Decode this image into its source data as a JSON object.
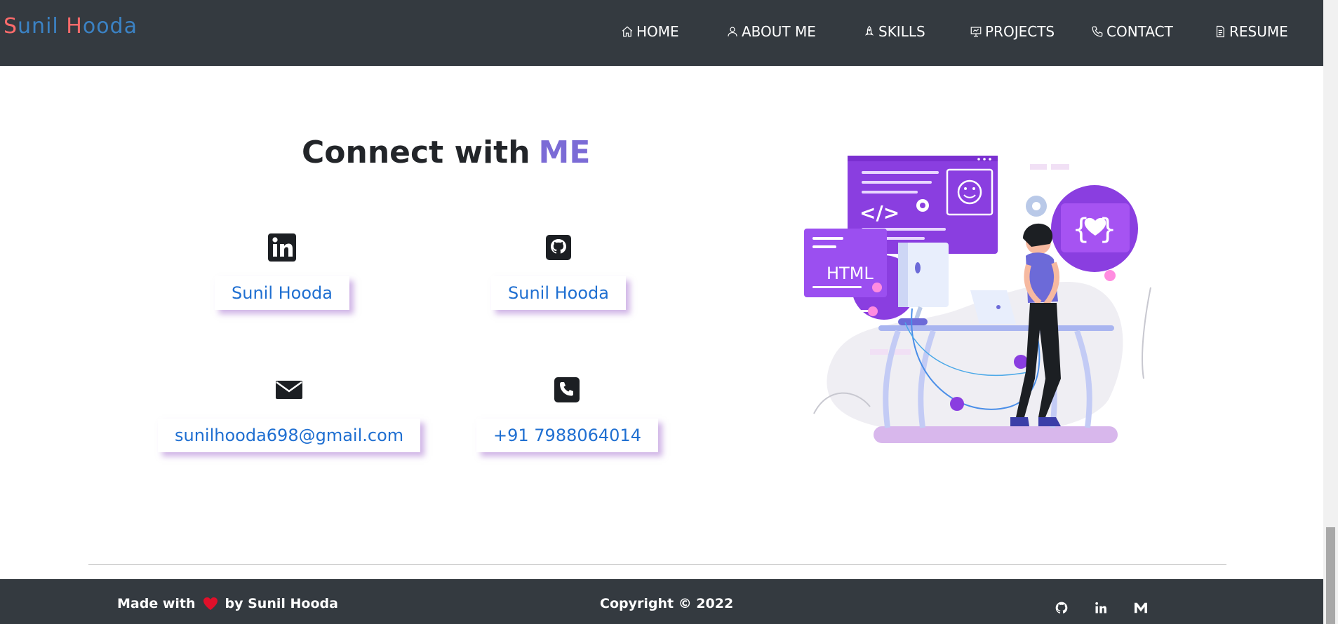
{
  "brand": {
    "letters": [
      "S",
      "unil ",
      "H",
      "ooda"
    ]
  },
  "nav": {
    "items": [
      {
        "label": "HOME",
        "icon": "home-icon"
      },
      {
        "label": "ABOUT ME",
        "icon": "user-icon"
      },
      {
        "label": "SKILLS",
        "icon": "rocket-icon"
      },
      {
        "label": "PROJECTS",
        "icon": "presentation-icon"
      },
      {
        "label": "CONTACT",
        "icon": "phone-icon"
      },
      {
        "label": "RESUME",
        "icon": "document-icon"
      }
    ]
  },
  "connect": {
    "heading_text": "Connect with",
    "heading_accent": "ME",
    "contacts": [
      {
        "icon": "linkedin-icon",
        "label": "Sunil Hooda"
      },
      {
        "icon": "github-icon",
        "label": "Sunil Hooda"
      },
      {
        "icon": "mail-icon",
        "label": "sunilhooda698@gmail.com"
      },
      {
        "icon": "phone-icon",
        "label": "+91 7988064014"
      }
    ]
  },
  "illustration": {
    "code_label": "HTML",
    "code_symbol": "</>"
  },
  "footer": {
    "made_with": "Made with",
    "by_text": "by Sunil Hooda",
    "copyright": "Copyright © 2022",
    "icons": [
      "github-icon",
      "linkedin-icon",
      "gmail-icon"
    ]
  },
  "colors": {
    "accent": "#7b6bd6",
    "link": "#1f6fd1",
    "dark": "#343a40",
    "heart": "#e0102a"
  }
}
